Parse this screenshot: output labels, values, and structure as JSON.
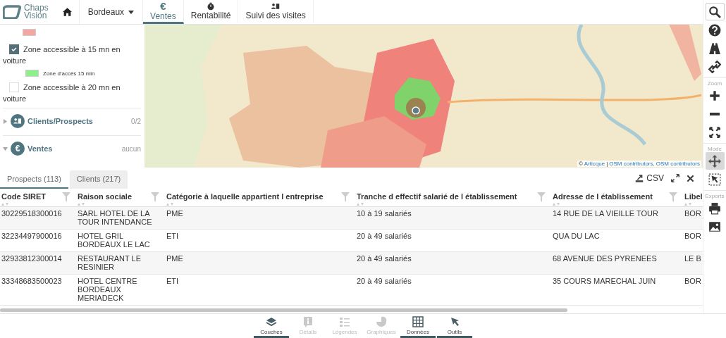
{
  "header": {
    "logo_lines": [
      "Chaps",
      "Vision"
    ],
    "city": "Bordeaux",
    "tabs": [
      {
        "label": "Ventes",
        "icon_text": "€",
        "selected": true
      },
      {
        "label": "Rentabilité",
        "selected": false
      },
      {
        "label": "Suivi des visites",
        "selected": false
      }
    ]
  },
  "layers_panel": {
    "top_legend": {
      "color": "#f4a6a0"
    },
    "layers": [
      {
        "label": "Zone accessible à 15 mn en voiture",
        "checked": true,
        "legend": {
          "label": "Zone d'accès 15 min",
          "color": "#8ef08a"
        }
      },
      {
        "label": "Zone accessible à 20 mn en voiture",
        "checked": false
      }
    ],
    "sections": [
      {
        "title": "Clients/Prospects",
        "count": "0/2",
        "expanded": false
      },
      {
        "title": "Ventes",
        "icon_text": "€",
        "count": "aucun",
        "expanded": true
      }
    ]
  },
  "map": {
    "attribution": [
      {
        "kind": "plain",
        "text": "©"
      },
      {
        "kind": "link",
        "text": "Articque"
      },
      {
        "kind": "plain",
        "text": "|"
      },
      {
        "kind": "link",
        "text": "OSM contributors,"
      },
      {
        "kind": "link",
        "text": "OSM contributors"
      }
    ]
  },
  "data_tabs": [
    {
      "label": "Prospects (113)",
      "selected": true
    },
    {
      "label": "Clients (217)",
      "selected": false
    }
  ],
  "export_label": "CSV",
  "table": {
    "columns": [
      {
        "label": "Code SIRET",
        "filter": true
      },
      {
        "label": "Raison sociale",
        "filter": true
      },
      {
        "label": "Catégorie à laquelle appartient l entreprise",
        "filter": true
      },
      {
        "label": "Tranche d effectif salarié de l établissement",
        "filter": true
      },
      {
        "label": "Adresse de l établissement",
        "filter": true
      },
      {
        "label": "Libel",
        "filter": false
      }
    ],
    "rows": [
      [
        "30229518300016",
        "SARL HOTEL DE LA TOUR INTENDANCE",
        "PME",
        "10 à 19 salariés",
        "14 RUE DE LA VIEILLE TOUR",
        "BOR"
      ],
      [
        "32234497900016",
        "HOTEL GRIL BORDEAUX LE LAC",
        "ETI",
        "20 à 49 salariés",
        "QUA DU LAC",
        "BOR"
      ],
      [
        "32933812300014",
        "RESTAURANT LE RESINIER",
        "PME",
        "20 à 49 salariés",
        "68 AVENUE DES PYRENEES",
        "LE B"
      ],
      [
        "33348683500023",
        "HOTEL CENTRE BORDEAUX MERIADECK",
        "ETI",
        "20 à 49 salariés",
        "35 COURS MARECHAL JUIN",
        "BOR"
      ]
    ]
  },
  "toolbar": {
    "zoom_label": "Zoom",
    "mode_label": "Mode",
    "exports_label": "Exports",
    "mode_buttons": [
      {
        "selected": true
      },
      {
        "selected": false
      }
    ]
  },
  "bottom_nav": [
    {
      "label": "Couches",
      "selected": true,
      "disabled": false
    },
    {
      "label": "Détails",
      "selected": false,
      "disabled": true
    },
    {
      "label": "Légendes",
      "selected": false,
      "disabled": true
    },
    {
      "label": "Graphiques",
      "selected": false,
      "disabled": true
    },
    {
      "label": "Données",
      "selected": true,
      "disabled": false
    },
    {
      "label": "Outils",
      "selected": true,
      "disabled": false
    }
  ]
}
